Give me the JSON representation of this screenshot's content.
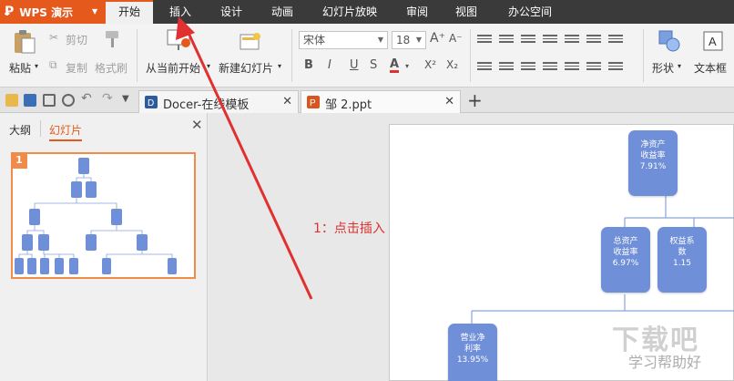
{
  "app": {
    "logo": "WPS 演示"
  },
  "menu": {
    "items": [
      "开始",
      "插入",
      "设计",
      "动画",
      "幻灯片放映",
      "审阅",
      "视图",
      "办公空间"
    ]
  },
  "ribbon": {
    "paste": "粘贴",
    "cut": "剪切",
    "copy": "复制",
    "format_painter": "格式刷",
    "from_current": "从当前开始",
    "new_slide": "新建幻灯片",
    "font_name": "宋体",
    "font_size": "18",
    "shape": "形状",
    "textbox": "文本框"
  },
  "tabs": [
    {
      "label": "Docer-在线模板"
    },
    {
      "label": "邹 2.ppt"
    }
  ],
  "panel": {
    "outline_tab": "大纲",
    "slides_tab": "幻灯片",
    "slide_number": "1"
  },
  "slide_nodes": {
    "n1": {
      "line1": "净资产",
      "line2": "收益率",
      "line3": "7.91%"
    },
    "n2": {
      "line1": "总资产",
      "line2": "收益率",
      "line3": "6.97%"
    },
    "n3": {
      "line1": "权益系",
      "line2": "数",
      "line3": "1.15"
    },
    "n4": {
      "line1": "营业净",
      "line2": "利率",
      "line3": "13.95%"
    }
  },
  "annotation": "1：点击插入",
  "watermark": {
    "main": "下载吧",
    "sub": "学习帮助好"
  },
  "colors": {
    "accent": "#e55a1c",
    "node": "#6f8fd8",
    "annotation": "#e03030"
  }
}
